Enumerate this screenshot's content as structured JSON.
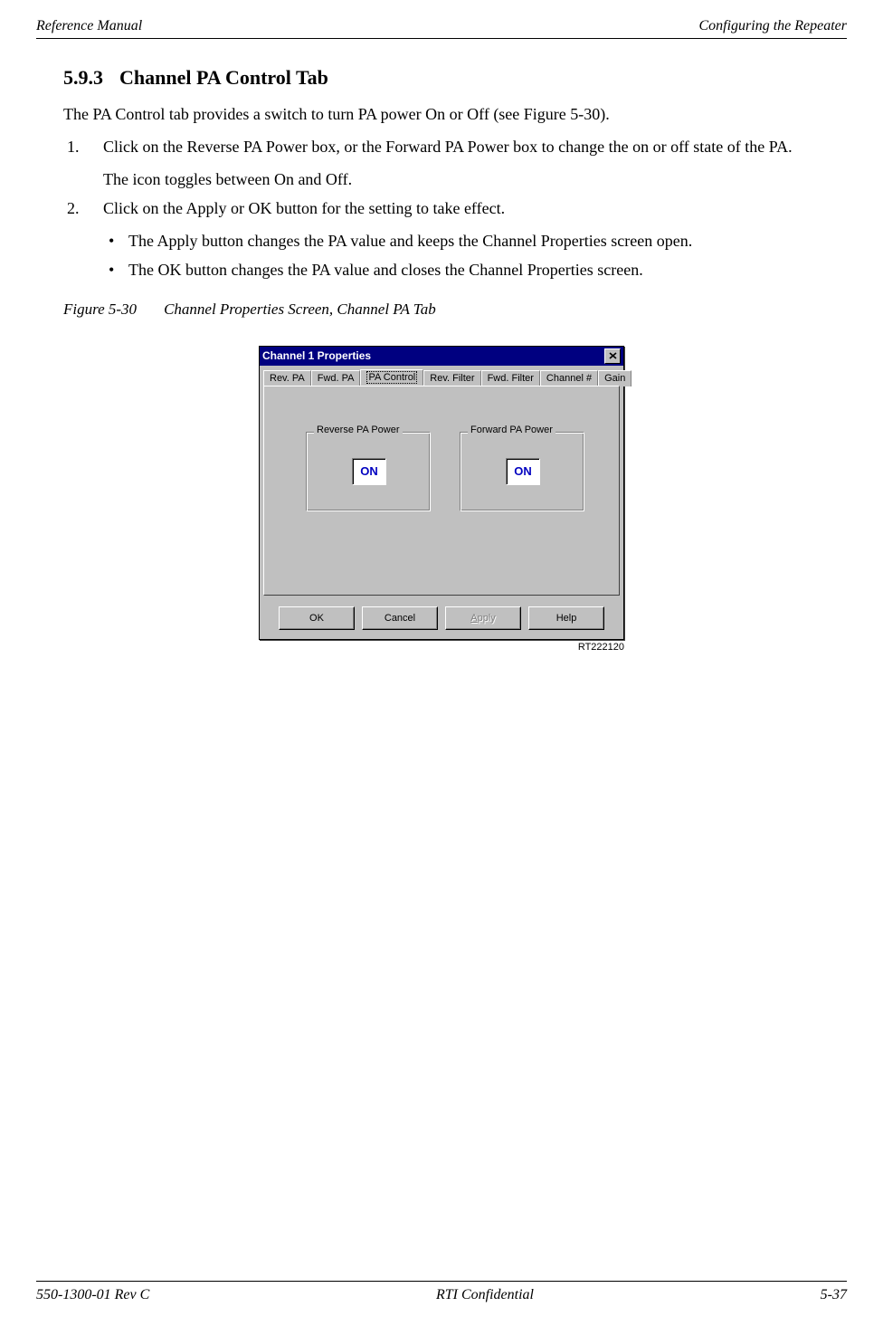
{
  "header": {
    "left": "Reference Manual",
    "right": "Configuring the Repeater"
  },
  "section": {
    "number": "5.9.3",
    "title": "Channel PA Control Tab"
  },
  "body": {
    "intro": "The PA Control tab provides a switch to turn PA power On or Off (see Figure 5-30).",
    "step1_marker": "1.",
    "step1": "Click on the Reverse PA Power box, or the Forward PA Power box to change the on or off state of the PA.",
    "step1_sub": "The icon toggles between On and Off.",
    "step2_marker": "2.",
    "step2": "Click on the Apply or OK button for the setting to take effect.",
    "bullet1": "The Apply button changes the PA value and keeps the Channel Properties screen open.",
    "bullet2": "The OK button changes the PA value and closes the Channel Properties screen."
  },
  "figure": {
    "number": "Figure 5-30",
    "caption": "Channel Properties Screen, Channel PA Tab",
    "rt": "RT222120"
  },
  "dialog": {
    "title": "Channel 1 Properties",
    "tabs": [
      "Rev. PA",
      "Fwd. PA",
      "PA Control",
      "Rev. Filter",
      "Fwd. Filter",
      "Channel #",
      "Gain"
    ],
    "active_tab_index": 2,
    "reverse_group": "Reverse PA Power",
    "forward_group": "Forward PA Power",
    "reverse_state": "ON",
    "forward_state": "ON",
    "buttons": {
      "ok": "OK",
      "cancel": "Cancel",
      "apply_prefix": "A",
      "apply_rest": "pply",
      "help": "Help"
    }
  },
  "footer": {
    "left": "550-1300-01 Rev C",
    "center": "RTI Confidential",
    "right": "5-37"
  }
}
